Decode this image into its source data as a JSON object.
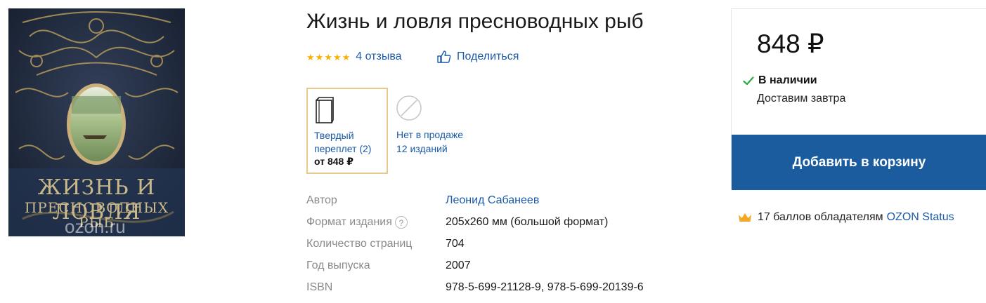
{
  "product": {
    "title": "Жизнь и ловля пресноводных рыб",
    "cover": {
      "title_line1": "ЖИЗНЬ И ЛОВЛЯ",
      "title_line2": "ПРЕСНОВОДНЫХ",
      "title_line3": "РЫБ",
      "watermark": "ozon.ru"
    }
  },
  "rating": {
    "stars": 5,
    "reviews_label": "4 отзыва"
  },
  "share": {
    "label": "Поделиться"
  },
  "editions": [
    {
      "label": "Твердый переплет (2)",
      "price": "от 848 ₽",
      "selected": true
    },
    {
      "label": "Нет в продаже",
      "sub_label": "12 изданий",
      "selected": false
    }
  ],
  "specs": [
    {
      "label": "Автор",
      "value": "Леонид Сабанеев",
      "is_link": true
    },
    {
      "label": "Формат издания",
      "value": "205x260 мм (большой формат)",
      "help": true
    },
    {
      "label": "Количество страниц",
      "value": "704"
    },
    {
      "label": "Год выпуска",
      "value": "2007"
    },
    {
      "label": "ISBN",
      "value": "978-5-699-21128-9, 978-5-699-20139-6"
    }
  ],
  "buy_box": {
    "price": "848 ₽",
    "availability": "В наличии",
    "delivery": "Доставим завтра",
    "add_to_cart": "Добавить в корзину"
  },
  "status_bonus": {
    "text": "17 баллов обладателям",
    "link": "OZON Status"
  },
  "colors": {
    "accent_blue": "#1a5c9e",
    "link_blue": "#1a5aa6",
    "star_yellow": "#f5b301",
    "check_green": "#2aa84a",
    "crown_orange": "#f5a623",
    "selected_border": "#e7c98b"
  }
}
